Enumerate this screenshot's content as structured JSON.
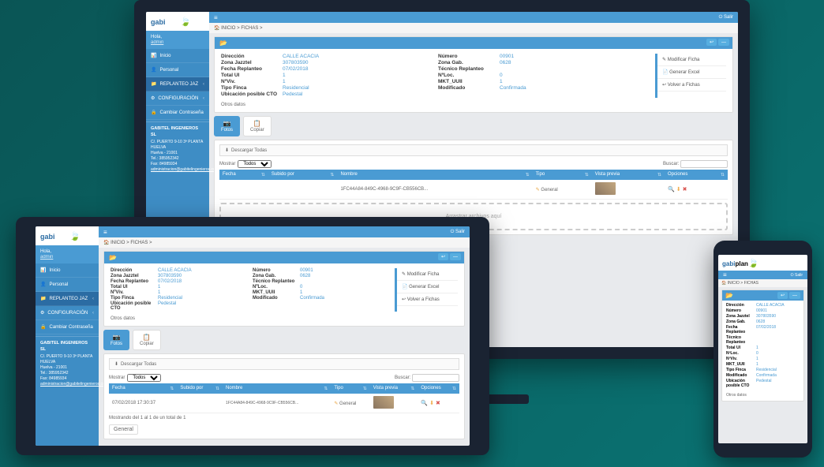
{
  "brand": {
    "name1": "gabi",
    "name2": "plan"
  },
  "hello": {
    "greeting": "Hola,",
    "user": "admin"
  },
  "nav": {
    "inicio": "Inicio",
    "personal": "Personal",
    "replanteo": "REPLANTEO JAZ",
    "config": "CONFIGURACIÓN",
    "cambiar": "Cambiar Contraseña"
  },
  "company": {
    "name": "GABITEL INGENIEROS SL",
    "line1": "C/. PUERTO 9-10 3ª PLANTA",
    "line2": "HUELVA",
    "line3": "Huelva - 21001",
    "line4": "Tel.: 385952342",
    "line5": "Fax: 84985934",
    "line6": "administracion@gabitelingenieros.com"
  },
  "topbar": {
    "salir": "Salir"
  },
  "breadcrumb": {
    "home": "INICIO",
    "sep": ">",
    "page": "FICHAS"
  },
  "fields": {
    "direccion_l": "Dirección",
    "direccion_v": "CALLE ACACIA",
    "zonajazz_l": "Zona Jazztel",
    "zonajazz_v": "307803590",
    "fecha_l": "Fecha Replanteo",
    "fecha_v": "07/02/2018",
    "totalui_l": "Total UI",
    "totalui_v": "1",
    "nviv_l": "NºViv.",
    "nviv_v": "1",
    "tipofinca_l": "Tipo Finca",
    "tipofinca_v": "Residencial",
    "ubic_l": "Ubicación posible CTO",
    "ubic_v": "Pedestal",
    "numero_l": "Número",
    "numero_v": "00901",
    "zonagab_l": "Zona Gab.",
    "zonagab_v": "0628",
    "tecnico_l": "Técnico Replanteo",
    "tecnico_v": "",
    "nloc_l": "NºLoc.",
    "nloc_v": "0",
    "mkt_l": "MKT_UUII",
    "mkt_v": "1",
    "modif_l": "Modificado",
    "modif_v": "Confirmada"
  },
  "otros": "Otros datos",
  "actions": {
    "modificar": "Modificar Ficha",
    "excel": "Generar Excel",
    "volver": "Volver a Fichas"
  },
  "tabs": {
    "fotos": "Fotos",
    "copiar": "Copiar"
  },
  "download": "Descargar Todas",
  "pagectrl": {
    "mostrar": "Mostrar",
    "todos": "Todos",
    "buscar": "Buscar:"
  },
  "table": {
    "h_fecha": "Fecha",
    "h_subido": "Subido por",
    "h_nombre": "Nombre",
    "h_tipo": "Tipo",
    "h_vista": "Vista previa",
    "h_op": "Opciones",
    "r_fecha": "07/02/2018 17:30:37",
    "r_subido": "",
    "r_nombre": "1FC44A84-849C-4968-9C9F-CB556CB...",
    "r_tipo": "General"
  },
  "pager": {
    "info": "Mostrando del 1 al 1 de un total de 1",
    "prev": "General"
  },
  "dropzone": "Arrastrar archivos aquí"
}
